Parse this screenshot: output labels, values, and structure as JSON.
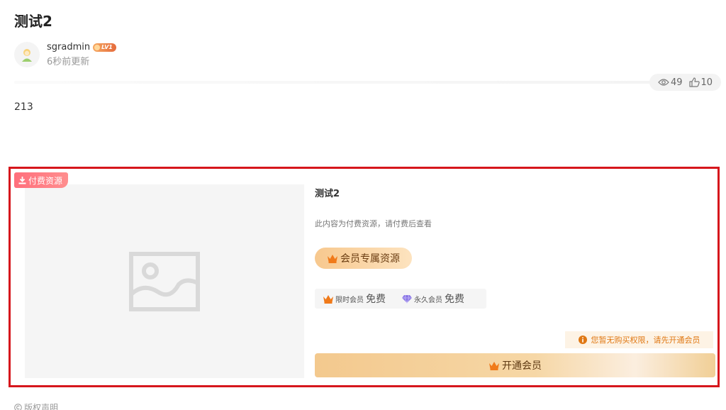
{
  "post": {
    "title": "测试2",
    "author_name": "sgradmin",
    "level": "LV1",
    "updated": "6秒前更新",
    "views": "49",
    "likes": "10",
    "content": "213"
  },
  "resource": {
    "tag": "付费资源",
    "title": "测试2",
    "description": "此内容为付费资源，请付费后查看",
    "member_label": "会员专属资源",
    "prices": [
      {
        "label": "限时会员",
        "value": "免费",
        "icon": "crown-icon"
      },
      {
        "label": "永久会员",
        "value": "免费",
        "icon": "diamond-icon"
      }
    ],
    "notice": "您暂无购买权限，请先开通会员",
    "open_button": "开通会员"
  },
  "footer": {
    "copyright": "版权声明"
  },
  "colors": {
    "highlight_border": "#d6161c",
    "paid_tag": "#ff7a86",
    "notice_text": "#e07813",
    "gold": "#f3c98e"
  }
}
